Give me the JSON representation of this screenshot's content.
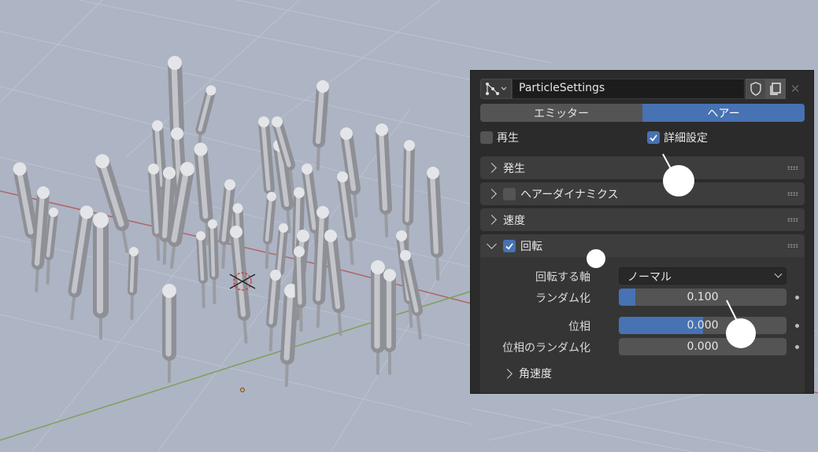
{
  "header": {
    "datablock_name": "ParticleSettings"
  },
  "type_tabs": [
    {
      "label": "エミッター",
      "active": false
    },
    {
      "label": "ヘアー",
      "active": true
    }
  ],
  "checkboxes": {
    "regrow": {
      "label": "再生",
      "checked": false
    },
    "advanced": {
      "label": "詳細設定",
      "checked": true
    }
  },
  "sections": {
    "emission": {
      "label": "発生"
    },
    "hair_dynamics": {
      "label": "ヘアーダイナミクス",
      "checked": false
    },
    "velocity": {
      "label": "速度"
    },
    "rotation": {
      "label": "回転",
      "checked": true,
      "expanded": true
    },
    "angular_velocity": {
      "label": "角速度"
    }
  },
  "rotation_props": {
    "axis": {
      "label": "回転する軸",
      "value": "ノーマル"
    },
    "randomize": {
      "label": "ランダム化",
      "value": "0.100",
      "fraction": 0.1
    },
    "phase": {
      "label": "位相",
      "value": "0.000",
      "fraction": 0.5
    },
    "phase_random": {
      "label": "位相のランダム化",
      "value": "0.000",
      "fraction": 0.0
    }
  },
  "colors": {
    "accent": "#4772b3",
    "panel": "#2b2b2b",
    "viewport": "#adb4c4"
  },
  "icons": [
    "particle-settings-icon",
    "shield-icon",
    "copy-icon",
    "close-icon",
    "checkmark-icon",
    "chevron-icon",
    "drag-grip-icon"
  ]
}
